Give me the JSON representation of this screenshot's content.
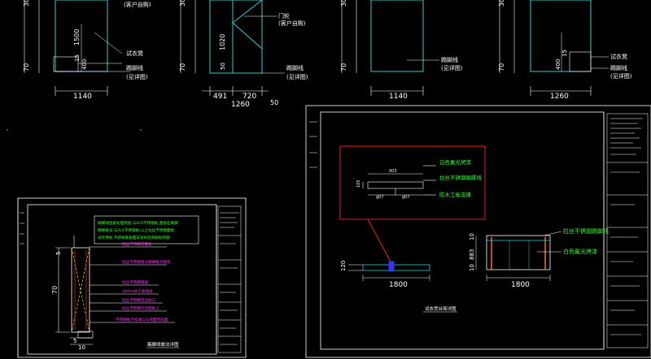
{
  "colors": {
    "background": "#000000",
    "frame": "#ffffff",
    "cyan": "#33cccc",
    "dim": "#ffffff",
    "green_text": "#33ff33",
    "magenta": "#ff33ff",
    "yellow": "#ffff33",
    "red": "#ff2020",
    "blue": "#3333ff",
    "orange": "#ff6633"
  },
  "top_elevations": {
    "panel1": {
      "height_dims": [
        "30",
        "70"
      ],
      "inner_dims": [
        "1500",
        "15",
        "400"
      ],
      "labels": [
        "(客户自购)",
        "试衣凳",
        "踢脚线",
        "(见详图)"
      ],
      "width_dim": "1140"
    },
    "panel2": {
      "height_dims": [
        "30",
        "70"
      ],
      "inner_dims": [
        "1020",
        "50"
      ],
      "labels": [
        "门轮",
        "(客户自购)",
        "踢脚线",
        "(见详图)"
      ],
      "width_dims": [
        "491",
        "720"
      ],
      "bottom_partial": "1260",
      "side_partial": "50"
    },
    "panel3": {
      "height_dims": [
        "30",
        "70"
      ],
      "labels": [
        "踢脚线",
        "(见详图)"
      ],
      "width_dim": "1140"
    },
    "panel4": {
      "height_dims": [
        "30",
        "70"
      ],
      "inner_dims": [
        "400",
        "15"
      ],
      "labels": [
        "试衣凳",
        "踢脚线",
        "(见详图)"
      ],
      "width_dim": "1260"
    }
  },
  "left_sheet": {
    "note_lines": [
      "踢脚线连接处理预留,与Ac5不锈钢板,面板在踢脚",
      "踢脚做法,与Ac5不锈钢板,以上拉丝不锈钢面板",
      "试衣凳板,不锈钢底板面安装好后再粘贴饰面"
    ],
    "callouts": [
      "拉丝不锈钢包面板",
      "拉丝不锈钢板与踢脚板交接处",
      "拉丝不锈钢面层",
      "18mm木工板基层",
      "拉丝不锈钢包边收口",
      "拉丝不锈钢外包面板上",
      "不锈钢板卡扣收口与地面完成面"
    ],
    "dims": [
      "5",
      "70",
      "5",
      "10"
    ],
    "title": "踢脚线做法详图"
  },
  "right_sheet": {
    "detail_labels": [
      "白色氟光烤漆",
      "拉丝不锈钢踢脚线",
      "防木工板支撑"
    ],
    "detail_dims": [
      "003",
      "105",
      "g07",
      "g07"
    ],
    "callouts": [
      "拉丝不锈钢踢脚线",
      "白色氟光烤漆"
    ],
    "left_dims": [
      "120",
      "1800"
    ],
    "right_dims": [
      "10",
      "883",
      "10",
      "1800"
    ],
    "title": "试衣凳台面详图"
  },
  "title_block": {
    "rows": [
      "项目名称",
      "图纸名称",
      "设计",
      "校对",
      "审核",
      "图号"
    ]
  }
}
